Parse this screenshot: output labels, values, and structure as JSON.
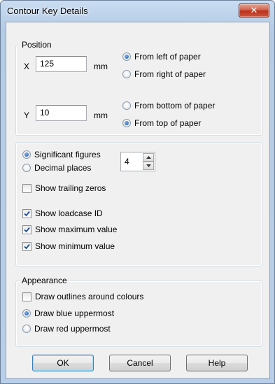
{
  "window": {
    "title": "Contour Key Details",
    "close_glyph": "✕"
  },
  "position": {
    "legend": "Position",
    "x_label": "X",
    "x_value": "125",
    "x_unit": "mm",
    "y_label": "Y",
    "y_value": "10",
    "y_unit": "mm",
    "from_left": "From left of paper",
    "from_right": "From right of paper",
    "from_bottom": "From bottom of paper",
    "from_top": "From top of paper",
    "horizontal_selected": "from_left",
    "vertical_selected": "from_top"
  },
  "format": {
    "significant_figures": "Significant figures",
    "decimal_places": "Decimal places",
    "digits_value": "4",
    "mode_selected": "significant_figures",
    "show_trailing_zeros": "Show trailing zeros",
    "show_trailing_zeros_checked": false,
    "show_loadcase_id": "Show loadcase ID",
    "show_loadcase_id_checked": true,
    "show_maximum_value": "Show maximum value",
    "show_maximum_value_checked": true,
    "show_minimum_value": "Show minimum value",
    "show_minimum_value_checked": true
  },
  "appearance": {
    "legend": "Appearance",
    "draw_outlines": "Draw outlines around colours",
    "draw_outlines_checked": false,
    "draw_blue": "Draw blue uppermost",
    "draw_red": "Draw red uppermost",
    "uppermost_selected": "blue"
  },
  "buttons": {
    "ok": "OK",
    "cancel": "Cancel",
    "help": "Help"
  },
  "icons": {
    "close": "close-icon",
    "spin_up": "triangle-up-icon",
    "spin_down": "triangle-down-icon",
    "check": "checkmark-icon"
  },
  "colors": {
    "accent": "#1a4f9c",
    "close_button": "#c7432d",
    "title_bar": "#b9cfe9"
  }
}
